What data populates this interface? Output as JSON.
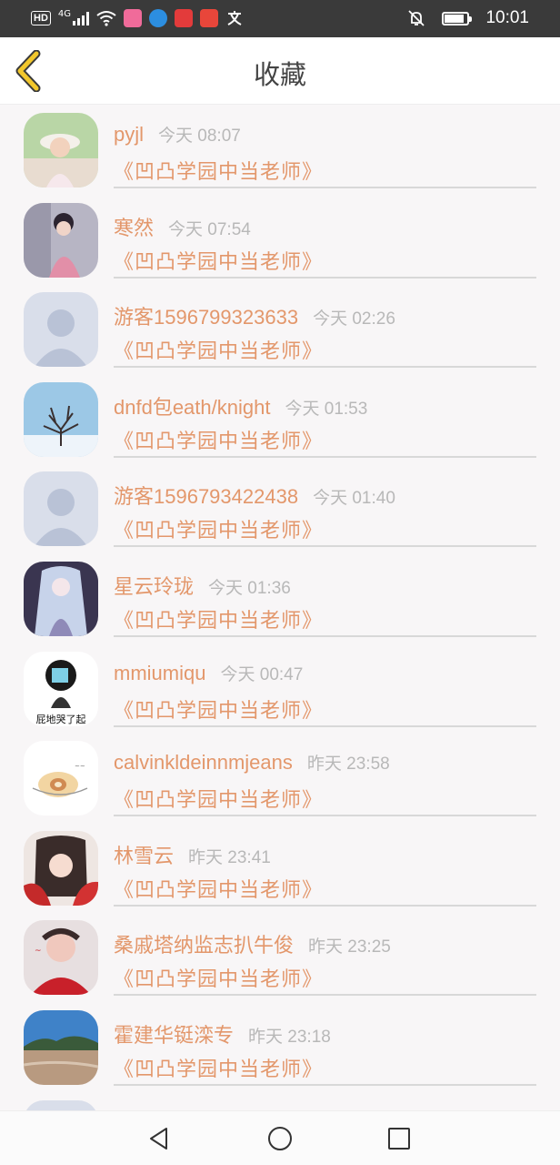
{
  "status_bar": {
    "network": "4G",
    "hd_label": "HD",
    "time": "10:01",
    "icons": [
      "signal-icon",
      "wifi-icon",
      "app-icon",
      "app-icon",
      "app-icon",
      "app-icon",
      "translate-icon",
      "mute-bell-icon",
      "battery-icon"
    ]
  },
  "header": {
    "title": "收藏",
    "back_icon": "chevron-left-icon",
    "accent": "#f2c72c"
  },
  "favorites": [
    {
      "name": "pyjl",
      "time": "今天 08:07",
      "book": "《凹凸学园中当老师》",
      "avatar": "girl-photo"
    },
    {
      "name": "寒然",
      "time": "今天 07:54",
      "book": "《凹凸学园中当老师》",
      "avatar": "girl-pink-photo"
    },
    {
      "name": "游客1596799323633",
      "time": "今天 02:26",
      "book": "《凹凸学园中当老师》",
      "avatar": "default-avatar"
    },
    {
      "name": "dnfd包eath/knight",
      "time": "今天 01:53",
      "book": "《凹凸学园中当老师》",
      "avatar": "snow-tree-photo"
    },
    {
      "name": "游客1596793422438",
      "time": "今天 01:40",
      "book": "《凹凸学园中当老师》",
      "avatar": "default-avatar"
    },
    {
      "name": "星云玲珑",
      "time": "今天 01:36",
      "book": "《凹凸学园中当老师》",
      "avatar": "anime-girl"
    },
    {
      "name": "mmiumiqu",
      "time": "今天 00:47",
      "book": "《凹凸学园中当老师》",
      "avatar": "meme-figure",
      "avatar_caption": "屁地哭了起"
    },
    {
      "name": "calvinkldeinnmjeans",
      "time": "昨天 23:58",
      "book": "《凹凸学园中当老师》",
      "avatar": "cake-roll"
    },
    {
      "name": "林雪云",
      "time": "昨天 23:41",
      "book": "《凹凸学园中当老师》",
      "avatar": "anime-red"
    },
    {
      "name": "桑戚塔纳监志扒牛俊",
      "time": "昨天 23:25",
      "book": "《凹凸学园中当老师》",
      "avatar": "woman-photo"
    },
    {
      "name": "霍建华铤滦专",
      "time": "昨天 23:18",
      "book": "《凹凸学园中当老师》",
      "avatar": "lake-photo"
    }
  ],
  "colors": {
    "name": "#e3976b",
    "time": "#b8b8b8",
    "separator": "#d8d8d8",
    "background": "#f8f6f7"
  },
  "nav_bar": {
    "back_icon": "triangle-back-icon",
    "home_icon": "circle-home-icon",
    "recents_icon": "square-recents-icon"
  }
}
